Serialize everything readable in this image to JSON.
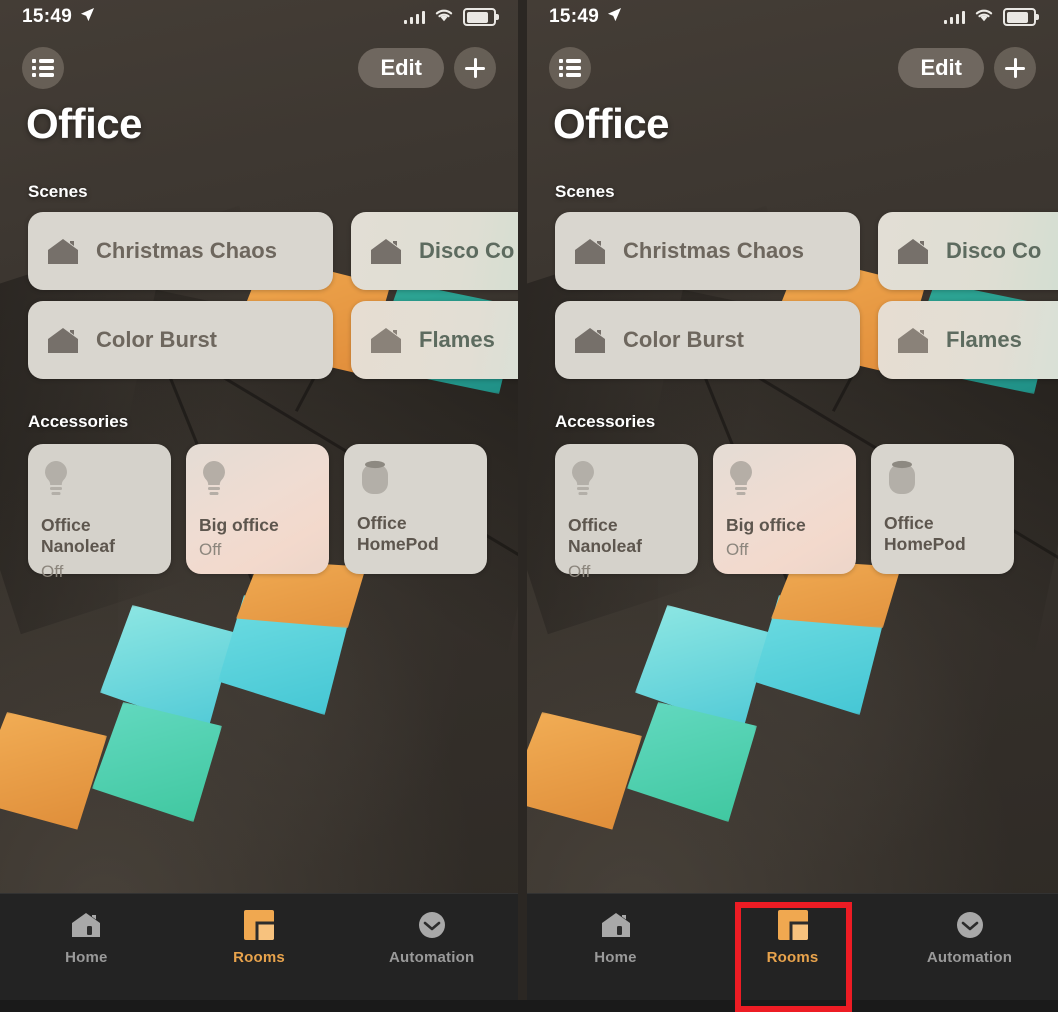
{
  "app": {
    "name": "Apple Home",
    "accent_orange": "#e8a34c",
    "highlight_red": "#ed1c24",
    "background": "#3b352f"
  },
  "status_bar": {
    "time": "15:49",
    "location_arrow_icon": "location-arrow-icon",
    "cellular_icon": "signal-bars-icon",
    "wifi_icon": "wifi-icon",
    "battery_icon": "battery-icon"
  },
  "nav": {
    "list_button_icon": "list-icon",
    "edit_label": "Edit",
    "add_button_icon": "plus-icon"
  },
  "header": {
    "title": "Office"
  },
  "sections": {
    "scenes_label": "Scenes",
    "accessories_label": "Accessories"
  },
  "scenes": [
    {
      "name": "Christmas Chaos",
      "icon": "house-icon"
    },
    {
      "name": "Disco Co",
      "icon": "house-icon"
    },
    {
      "name": "Color Burst",
      "icon": "house-icon"
    },
    {
      "name": "Flames",
      "icon": "house-icon"
    }
  ],
  "accessories": [
    {
      "name": "Office Nanoleaf",
      "state": "Off",
      "icon": "lightbulb-icon"
    },
    {
      "name": "Big office",
      "state": "Off",
      "icon": "lightbulb-icon"
    },
    {
      "name": "Office HomePod",
      "state": "",
      "icon": "homepod-icon"
    }
  ],
  "tabs": [
    {
      "label": "Home",
      "icon": "home-icon",
      "active": false
    },
    {
      "label": "Rooms",
      "icon": "rooms-icon",
      "active": true
    },
    {
      "label": "Automation",
      "icon": "clock-icon",
      "active": false
    }
  ],
  "annotation": {
    "highlight_target": "Rooms",
    "highlight_color": "#ed1c24"
  }
}
